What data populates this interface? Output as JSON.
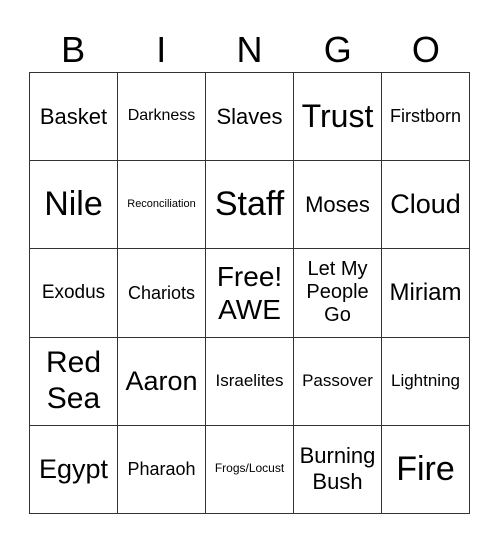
{
  "header": {
    "letters": [
      "B",
      "I",
      "N",
      "G",
      "O"
    ]
  },
  "cells": [
    [
      "Basket",
      "Darkness",
      "Slaves",
      "Trust",
      "Firstborn"
    ],
    [
      "Nile",
      "Reconciliation",
      "Staff",
      "Moses",
      "Cloud"
    ],
    [
      "Exodus",
      "Chariots",
      "Free! AWE",
      "Let My People Go",
      "Miriam"
    ],
    [
      "Red Sea",
      "Aaron",
      "Israelites",
      "Passover",
      "Lightning"
    ],
    [
      "Egypt",
      "Pharaoh",
      "Frogs/Locust",
      "Burning Bush",
      "Fire"
    ]
  ]
}
